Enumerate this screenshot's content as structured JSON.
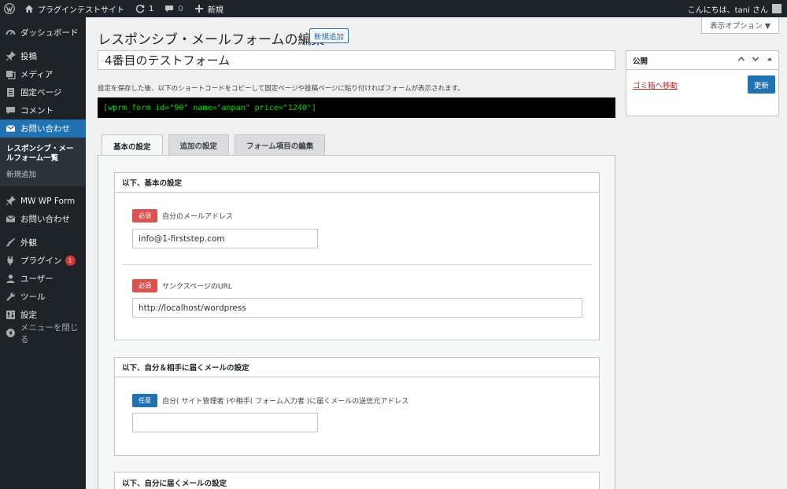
{
  "adminbar": {
    "site_name": "プラグインテストサイト",
    "updates_count": "1",
    "comments_count": "0",
    "new_label": "新規",
    "greeting": "こんにちは、tani さん"
  },
  "sidebar": {
    "items": [
      {
        "label": "ダッシュボード"
      },
      {
        "label": "投稿"
      },
      {
        "label": "メディア"
      },
      {
        "label": "固定ページ"
      },
      {
        "label": "コメント"
      },
      {
        "label": "お問い合わせ"
      },
      {
        "label": "MW WP Form"
      },
      {
        "label": "お問い合わせ"
      },
      {
        "label": "外観"
      },
      {
        "label": "プラグイン",
        "badge": "1"
      },
      {
        "label": "ユーザー"
      },
      {
        "label": "ツール"
      },
      {
        "label": "設定"
      },
      {
        "label": "メニューを閉じる"
      }
    ],
    "submenu": [
      {
        "label": "レスポンシブ・メールフォーム一覧"
      },
      {
        "label": "新規追加"
      }
    ]
  },
  "header": {
    "screen_options": "表示オプション ▼",
    "title": "レスポンシブ・メールフォームの編集",
    "add_new": "新規追加"
  },
  "form": {
    "title_value": "4番目のテストフォーム",
    "hint": "設定を保存した後、以下のショートコードをコピーして固定ページや投稿ページに貼り付ければフォームが表示されます。",
    "shortcode": "[wprm_form id=\"90\" name=\"anpan\" price=\"1240\"]"
  },
  "tabs": [
    {
      "label": "基本の設定"
    },
    {
      "label": "追加の設定"
    },
    {
      "label": "フォーム項目の編集"
    }
  ],
  "boxes": {
    "basic": {
      "title": "以下、基本の設定",
      "email_badge": "必須",
      "email_label": "自分のメールアドレス",
      "email_value": "info@1-firststep.com",
      "thanks_badge": "必須",
      "thanks_label": "サンクスページのURL",
      "thanks_value": "http://localhost/wordpress"
    },
    "both": {
      "title": "以下、自分＆相手に届くメールの設定",
      "from_badge": "任意",
      "from_label": "自分( サイト管理者 )や相手( フォーム入力者 )に届くメールの送信元アドレス",
      "from_value": ""
    },
    "self": {
      "title": "以下、自分に届くメールの設定"
    }
  },
  "publish": {
    "title": "公開",
    "trash": "ゴミ箱へ移動",
    "update": "更新"
  }
}
